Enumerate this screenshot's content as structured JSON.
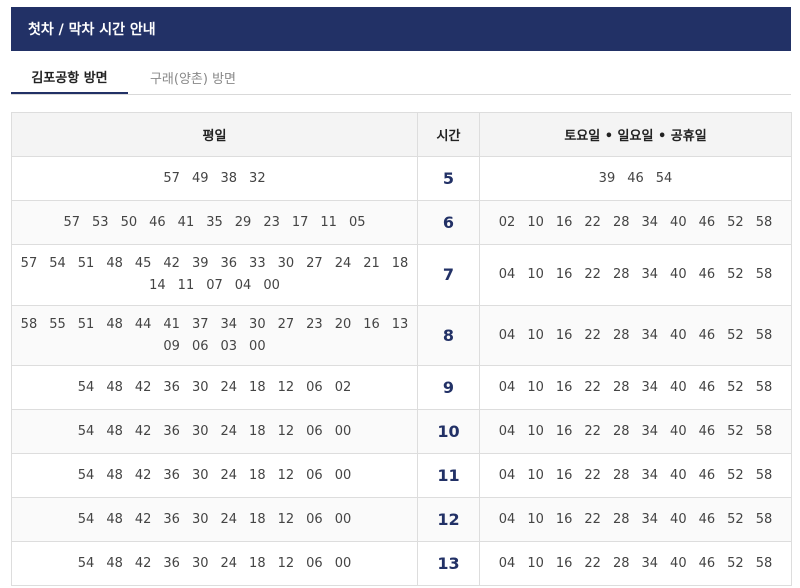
{
  "title": "첫차 / 막차 시간 안내",
  "tabs": [
    {
      "label": "김포공항 방면"
    },
    {
      "label": "구래(양촌) 방면"
    }
  ],
  "table": {
    "headers": {
      "weekday": "평일",
      "hour": "시간",
      "weekend": "토요일 • 일요일 • 공휴일"
    },
    "rows": [
      {
        "hour": "5",
        "weekday": [
          "57",
          "49",
          "38",
          "32"
        ],
        "weekend": [
          "39",
          "46",
          "54"
        ]
      },
      {
        "hour": "6",
        "weekday": [
          "57",
          "53",
          "50",
          "46",
          "41",
          "35",
          "29",
          "23",
          "17",
          "11",
          "05"
        ],
        "weekend": [
          "02",
          "10",
          "16",
          "22",
          "28",
          "34",
          "40",
          "46",
          "52",
          "58"
        ]
      },
      {
        "hour": "7",
        "weekday": [
          "57",
          "54",
          "51",
          "48",
          "45",
          "42",
          "39",
          "36",
          "33",
          "30",
          "27",
          "24",
          "21",
          "18",
          "14",
          "11",
          "07",
          "04",
          "00"
        ],
        "weekend": [
          "04",
          "10",
          "16",
          "22",
          "28",
          "34",
          "40",
          "46",
          "52",
          "58"
        ]
      },
      {
        "hour": "8",
        "weekday": [
          "58",
          "55",
          "51",
          "48",
          "44",
          "41",
          "37",
          "34",
          "30",
          "27",
          "23",
          "20",
          "16",
          "13",
          "09",
          "06",
          "03",
          "00"
        ],
        "weekend": [
          "04",
          "10",
          "16",
          "22",
          "28",
          "34",
          "40",
          "46",
          "52",
          "58"
        ]
      },
      {
        "hour": "9",
        "weekday": [
          "54",
          "48",
          "42",
          "36",
          "30",
          "24",
          "18",
          "12",
          "06",
          "02"
        ],
        "weekend": [
          "04",
          "10",
          "16",
          "22",
          "28",
          "34",
          "40",
          "46",
          "52",
          "58"
        ]
      },
      {
        "hour": "10",
        "weekday": [
          "54",
          "48",
          "42",
          "36",
          "30",
          "24",
          "18",
          "12",
          "06",
          "00"
        ],
        "weekend": [
          "04",
          "10",
          "16",
          "22",
          "28",
          "34",
          "40",
          "46",
          "52",
          "58"
        ]
      },
      {
        "hour": "11",
        "weekday": [
          "54",
          "48",
          "42",
          "36",
          "30",
          "24",
          "18",
          "12",
          "06",
          "00"
        ],
        "weekend": [
          "04",
          "10",
          "16",
          "22",
          "28",
          "34",
          "40",
          "46",
          "52",
          "58"
        ]
      },
      {
        "hour": "12",
        "weekday": [
          "54",
          "48",
          "42",
          "36",
          "30",
          "24",
          "18",
          "12",
          "06",
          "00"
        ],
        "weekend": [
          "04",
          "10",
          "16",
          "22",
          "28",
          "34",
          "40",
          "46",
          "52",
          "58"
        ]
      },
      {
        "hour": "13",
        "weekday": [
          "54",
          "48",
          "42",
          "36",
          "30",
          "24",
          "18",
          "12",
          "06",
          "00"
        ],
        "weekend": [
          "04",
          "10",
          "16",
          "22",
          "28",
          "34",
          "40",
          "46",
          "52",
          "58"
        ]
      }
    ]
  }
}
